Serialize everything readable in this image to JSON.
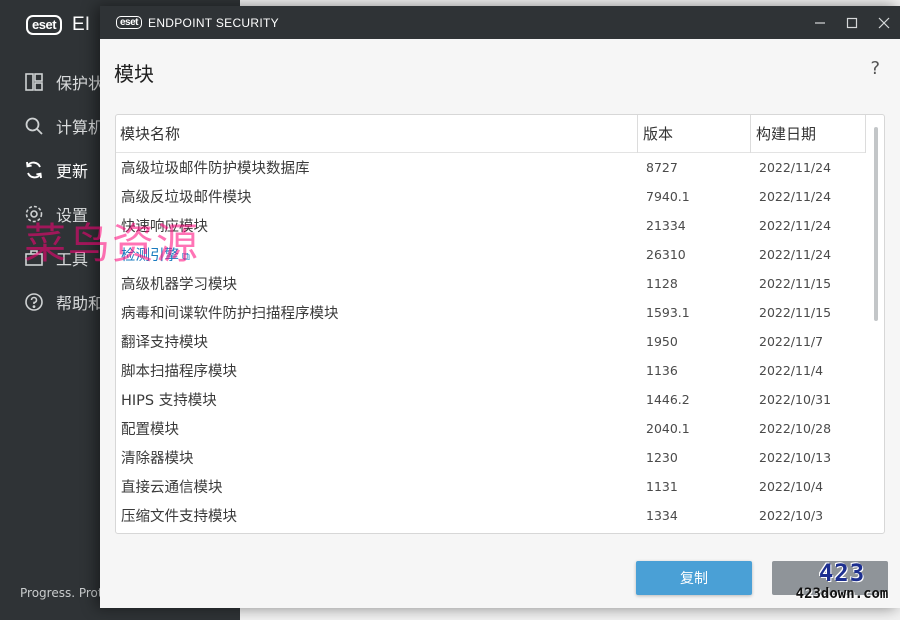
{
  "background": {
    "logo_badge": "eset",
    "logo_text": "EI",
    "nav": [
      {
        "label": "保护状",
        "icon": "dashboard-icon"
      },
      {
        "label": "计算机",
        "icon": "search-icon"
      },
      {
        "label": "更新",
        "icon": "refresh-icon",
        "active": true
      },
      {
        "label": "设置",
        "icon": "gear-icon"
      },
      {
        "label": "工具",
        "icon": "briefcase-icon"
      },
      {
        "label": "帮助和",
        "icon": "help-circle-icon"
      }
    ],
    "footer": "Progress. Prot"
  },
  "dialog": {
    "title_badge": "eset",
    "title": "ENDPOINT SECURITY",
    "heading": "模块",
    "help": "?",
    "columns": [
      "模块名称",
      "版本",
      "构建日期"
    ],
    "rows": [
      {
        "name": "高级垃圾邮件防护模块数据库",
        "version": "8727",
        "date": "2022/11/24"
      },
      {
        "name": "高级反垃圾邮件模块",
        "version": "7940.1",
        "date": "2022/11/24"
      },
      {
        "name": "快速响应模块",
        "version": "21334",
        "date": "2022/11/24"
      },
      {
        "name": "检测引擎",
        "version": "26310",
        "date": "2022/11/24",
        "link": true
      },
      {
        "name": "高级机器学习模块",
        "version": "1128",
        "date": "2022/11/15"
      },
      {
        "name": "病毒和间谍软件防护扫描程序模块",
        "version": "1593.1",
        "date": "2022/11/15"
      },
      {
        "name": "翻译支持模块",
        "version": "1950",
        "date": "2022/11/7"
      },
      {
        "name": "脚本扫描程序模块",
        "version": "1136",
        "date": "2022/11/4"
      },
      {
        "name": "HIPS 支持模块",
        "version": "1446.2",
        "date": "2022/10/31"
      },
      {
        "name": "配置模块",
        "version": "2040.1",
        "date": "2022/10/28"
      },
      {
        "name": "清除器模块",
        "version": "1230",
        "date": "2022/10/13"
      },
      {
        "name": "直接云通信模块",
        "version": "1131",
        "date": "2022/10/4"
      },
      {
        "name": "压缩文件支持模块",
        "version": "1334",
        "date": "2022/10/3"
      }
    ],
    "copy_button": "复制",
    "close_button": ""
  },
  "watermarks": {
    "cn": "菜鸟资源",
    "site_big": "423",
    "site_small": "423down.com"
  },
  "colors": {
    "accent": "#4aa0d6",
    "link": "#1a7bbf",
    "dark_chrome": "#2f3336"
  }
}
